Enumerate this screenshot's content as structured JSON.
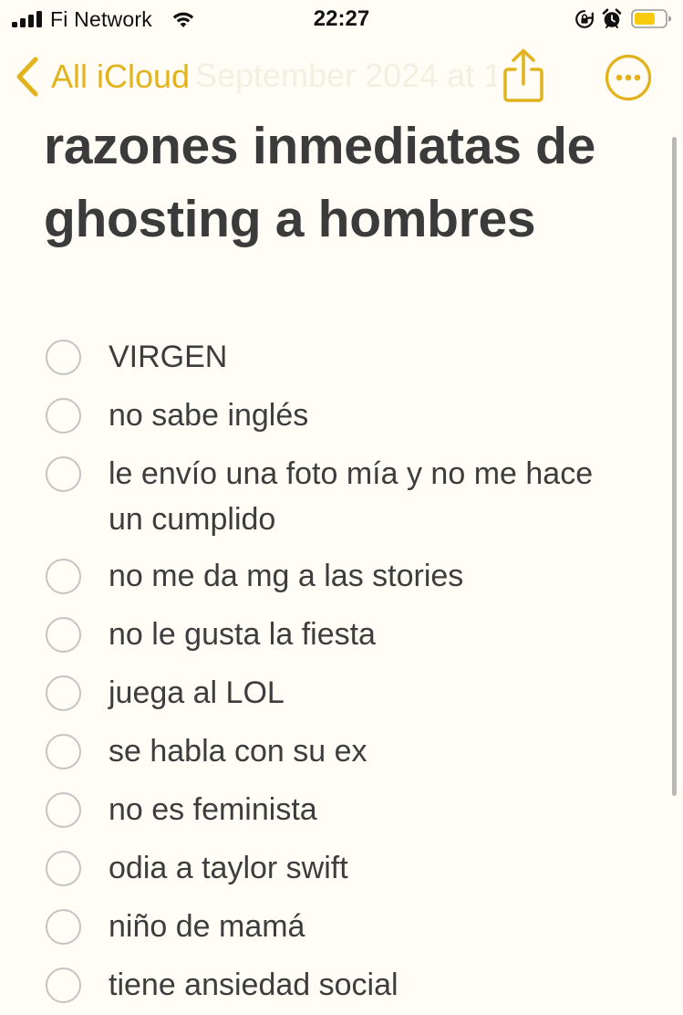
{
  "status_bar": {
    "carrier": "Fi Network",
    "time": "22:27",
    "battery_color": "#f8cc0c"
  },
  "nav": {
    "back_label": "All iCloud",
    "faded_date": "September 2024 at 17",
    "accent_color": "#e2b31d",
    "icons": [
      "chevron-left-icon",
      "share-icon",
      "more-icon"
    ]
  },
  "note": {
    "title": "razones inmediatas de ghosting a hombres",
    "checklist": [
      {
        "text": "VIRGEN",
        "checked": false
      },
      {
        "text": "no sabe inglés",
        "checked": false
      },
      {
        "text": "le envío una foto mía y no me hace un cumplido",
        "checked": false
      },
      {
        "text": "no me da mg a las stories",
        "checked": false
      },
      {
        "text": "no le gusta la fiesta",
        "checked": false
      },
      {
        "text": "juega al LOL",
        "checked": false
      },
      {
        "text": "se habla con su ex",
        "checked": false
      },
      {
        "text": "no es feminista",
        "checked": false
      },
      {
        "text": "odia a taylor swift",
        "checked": false
      },
      {
        "text": "niño de mamá",
        "checked": false
      },
      {
        "text": "tiene ansiedad social",
        "checked": false
      }
    ]
  }
}
